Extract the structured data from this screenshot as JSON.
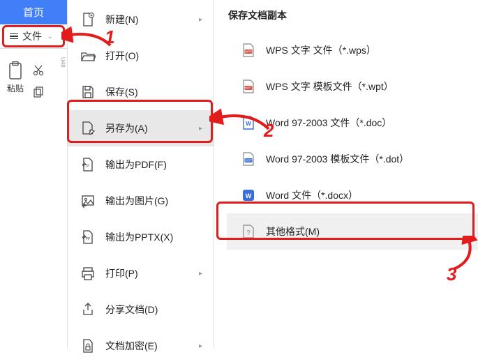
{
  "tabs": {
    "home": "首页"
  },
  "file_btn": {
    "label": "文件"
  },
  "paste": {
    "label": "粘贴"
  },
  "vert": "U48",
  "menu": {
    "new": "新建(N)",
    "open": "打开(O)",
    "save": "保存(S)",
    "saveas": "另存为(A)",
    "pdf": "输出为PDF(F)",
    "image": "输出为图片(G)",
    "pptx": "输出为PPTX(X)",
    "print": "打印(P)",
    "share": "分享文档(D)",
    "encrypt": "文档加密(E)"
  },
  "submenu": {
    "title": "保存文档副本",
    "wps": "WPS 文字 文件（*.wps）",
    "wpt": "WPS 文字 模板文件（*.wpt）",
    "doc": "Word 97-2003 文件（*.doc）",
    "dot": "Word 97-2003 模板文件（*.dot）",
    "docx": "Word 文件（*.docx）",
    "other": "其他格式(M)"
  },
  "annot": {
    "n1": "1",
    "n2": "2",
    "n3": "3"
  }
}
